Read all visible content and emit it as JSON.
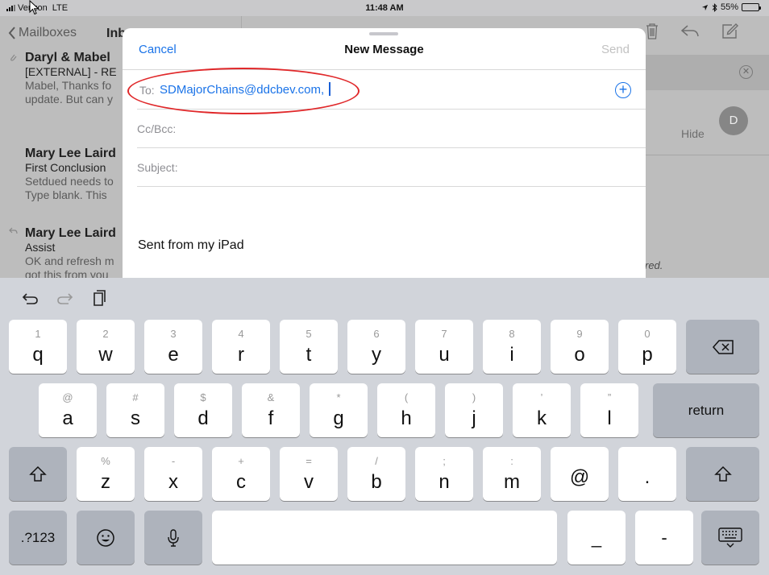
{
  "status_bar": {
    "carrier": "Verizon",
    "network": "LTE",
    "time": "11:48 AM",
    "battery": "55%",
    "battery_level": 0.55
  },
  "mail_list": {
    "back_label": "Mailboxes",
    "inbox_label": "Inb",
    "messages": [
      {
        "sender": "Daryl & Mabel",
        "subject": "[EXTERNAL] - RE",
        "preview_1": "Mabel, Thanks fo",
        "preview_2": "update. But can y"
      },
      {
        "sender": "Mary Lee Laird",
        "subject": "First Conclusion",
        "preview_1": "Setdued needs to",
        "preview_2": "Type blank. This"
      },
      {
        "sender": "Mary Lee Laird",
        "subject": "Assist",
        "preview_1": "OK and refresh m",
        "preview_2": "got this from you"
      }
    ]
  },
  "detail": {
    "avatar_initial": "D",
    "hide_label": "Hide",
    "italic_fragment": "red."
  },
  "compose": {
    "cancel_label": "Cancel",
    "title": "New Message",
    "send_label": "Send",
    "to_label": "To:",
    "to_value": "SDMajorChains@ddcbev.com,",
    "cc_label": "Cc/Bcc:",
    "subject_label": "Subject:",
    "body": "Sent from my iPad"
  },
  "keyboard": {
    "row1": [
      {
        "alt": "1",
        "key": "q"
      },
      {
        "alt": "2",
        "key": "w"
      },
      {
        "alt": "3",
        "key": "e"
      },
      {
        "alt": "4",
        "key": "r"
      },
      {
        "alt": "5",
        "key": "t"
      },
      {
        "alt": "6",
        "key": "y"
      },
      {
        "alt": "7",
        "key": "u"
      },
      {
        "alt": "8",
        "key": "i"
      },
      {
        "alt": "9",
        "key": "o"
      },
      {
        "alt": "0",
        "key": "p"
      }
    ],
    "row2": [
      {
        "alt": "@",
        "key": "a"
      },
      {
        "alt": "#",
        "key": "s"
      },
      {
        "alt": "$",
        "key": "d"
      },
      {
        "alt": "&",
        "key": "f"
      },
      {
        "alt": "*",
        "key": "g"
      },
      {
        "alt": "(",
        "key": "h"
      },
      {
        "alt": ")",
        "key": "j"
      },
      {
        "alt": "’",
        "key": "k"
      },
      {
        "alt": "”",
        "key": "l"
      }
    ],
    "return_label": "return",
    "row3": [
      {
        "alt": "%",
        "key": "z"
      },
      {
        "alt": "-",
        "key": "x"
      },
      {
        "alt": "+",
        "key": "c"
      },
      {
        "alt": "=",
        "key": "v"
      },
      {
        "alt": "/",
        "key": "b"
      },
      {
        "alt": ";",
        "key": "n"
      },
      {
        "alt": ":",
        "key": "m"
      },
      {
        "alt": "",
        "key": "@"
      },
      {
        "alt": "",
        "key": "."
      }
    ],
    "numbers_label": ".?123",
    "underscore_label": "_",
    "dash_label": "-"
  }
}
